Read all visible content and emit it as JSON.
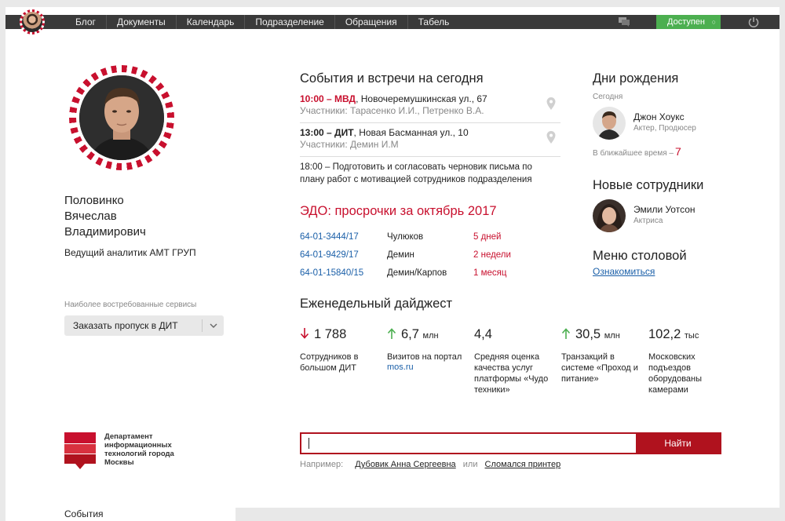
{
  "nav": {
    "items": [
      "Блог",
      "Документы",
      "Календарь",
      "Подразделение",
      "Обращения",
      "Табель"
    ],
    "status": "Доступен",
    "icons": [
      "avatar",
      "chat-icon",
      "chevron-down-icon",
      "power-icon"
    ]
  },
  "profile": {
    "name_lines": [
      "Половинко",
      "Вячеслав",
      "Владимирович"
    ],
    "role": "Ведущий аналитик АМТ ГРУП",
    "services_label": "Наиболее востребованные сервисы",
    "services_selected": "Заказать пропуск в ДИТ"
  },
  "events": {
    "title": "События и встречи на сегодня",
    "items": [
      {
        "time": "10:00 – МВД",
        "place": ", Новочеремушкинская ул., 67",
        "participants": "Участники: Тарасенко И.И., Петренко В.А."
      },
      {
        "time": "13:00 – ДИТ",
        "place": ", Новая Басманная ул., 10",
        "participants": "Участники: Демин И.М"
      }
    ],
    "task": "18:00 – Подготовить и согласовать черновик письма по плану работ с мотивацией сотрудников подразделения"
  },
  "edo": {
    "title": "ЭДО: просрочки за октябрь 2017",
    "rows": [
      {
        "number": "64-01-3444/17",
        "person": "Чулюков",
        "delay": "5 дней"
      },
      {
        "number": "64-01-9429/17",
        "person": "Демин",
        "delay": "2 недели"
      },
      {
        "number": "64-01-15840/15",
        "person": "Демин/Карпов",
        "delay": "1 месяц"
      }
    ]
  },
  "digest": {
    "title": "Еженедельный дайджест",
    "items": [
      {
        "trend": "down",
        "value": "1 788",
        "unit": "",
        "desc": "Сотрудников в большом ДИТ",
        "link": ""
      },
      {
        "trend": "up",
        "value": "6,7",
        "unit": "млн",
        "desc": "Визитов на портал",
        "link": "mos.ru"
      },
      {
        "trend": "none",
        "value": "4,4",
        "unit": "",
        "desc": "Средняя оценка качества услуг платформы «Чудо техники»",
        "link": ""
      },
      {
        "trend": "up",
        "value": "30,5",
        "unit": "млн",
        "desc": "Транзакций в системе «Проход и питание»",
        "link": ""
      },
      {
        "trend": "none",
        "value": "102,2",
        "unit": "тыс",
        "desc": "Московских подъездов оборудованы камерами",
        "link": ""
      }
    ],
    "colors": {
      "up": "#4caf50",
      "down": "#c8102e"
    }
  },
  "birthdays": {
    "title": "Дни рождения",
    "today_label": "Сегодня",
    "person": {
      "name": "Джон Хоукс",
      "role": "Актер, Продюсер"
    },
    "upcoming_label": "В ближайшее время –",
    "upcoming_count": "7"
  },
  "new_staff": {
    "title": "Новые сотрудники",
    "person": {
      "name": "Эмили Уотсон",
      "role": "Актриса"
    }
  },
  "canteen": {
    "title": "Меню столовой",
    "link": "Ознакомиться"
  },
  "footer": {
    "org_name": "Департамент информационных технологий города Москвы",
    "search_value": "",
    "search_button": "Найти",
    "hint_prefix": "Например:",
    "hint_example_1": "Дубовик Анна Сергеевна",
    "hint_or": "или",
    "hint_example_2": "Сломался принтер",
    "events_tab": "События"
  },
  "colors": {
    "accent": "#c8102e",
    "link": "#1a5fa8",
    "status": "#4caf50",
    "topbar": "#3a3a3a"
  }
}
